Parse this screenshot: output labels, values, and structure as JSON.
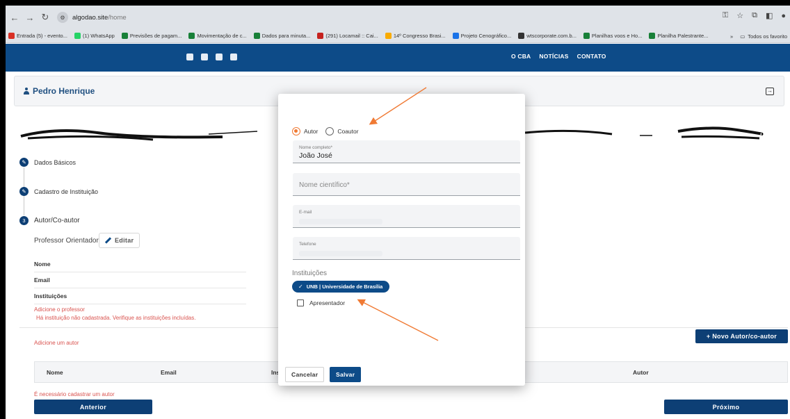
{
  "browser": {
    "url_domain": "algodao.site",
    "url_path": "/home",
    "bookmarks": [
      {
        "label": "Entrada (5) - evento...",
        "color": "#d93025"
      },
      {
        "label": "(1) WhatsApp",
        "color": "#25d366"
      },
      {
        "label": "Previsões de pagam...",
        "color": "#188038"
      },
      {
        "label": "Movimentação de c...",
        "color": "#188038"
      },
      {
        "label": "Dados para minuta...",
        "color": "#188038"
      },
      {
        "label": "(291) Locamail :: Cai...",
        "color": "#c5221f"
      },
      {
        "label": "14º Congresso Brasi...",
        "color": "#f9ab00"
      },
      {
        "label": "Projeto Cenográfico...",
        "color": "#1a73e8"
      },
      {
        "label": "wtscorporate.com.b...",
        "color": "#333333"
      },
      {
        "label": "Planilhas voos e Ho...",
        "color": "#188038"
      },
      {
        "label": "Planilha Palestrante...",
        "color": "#188038"
      }
    ],
    "bookmarks_more": "»",
    "all_bookmarks": "Todos os favorito"
  },
  "site": {
    "nav": [
      "O CBA",
      "NOTÍCIAS",
      "CONTATO"
    ]
  },
  "user": {
    "name": "Pedro Henrique"
  },
  "steps": {
    "step1": "Dados Básicos",
    "step2": "Cadastro de Instituição",
    "step3_num": "3",
    "step3": "Autor/Co-autor"
  },
  "professor": {
    "label": "Professor Orientador",
    "edit_label": "Editar",
    "rows": [
      "Nome",
      "Email",
      "Instituições"
    ],
    "warn_add": "Adicione o professor",
    "warn_inst": "Há instituição não cadastrada. Verifique as instituições incluídas."
  },
  "authors": {
    "add_label": "Adicione um autor",
    "new_button": "+ Novo Autor/co-autor",
    "columns": [
      "Nome",
      "Email",
      "Instit",
      "Autor"
    ],
    "required_warn": "É necessário cadastrar um autor"
  },
  "footer": {
    "prev": "Anterior",
    "next": "Próximo"
  },
  "modal": {
    "radio_autor": "Autor",
    "radio_coautor": "Coautor",
    "selected_radio": "Autor",
    "nome_label": "Nome completo*",
    "nome_value": "João José",
    "cientifico_placeholder": "Nome científico*",
    "email_label": "E-mail",
    "telefone_label": "Telefone",
    "instituicoes_title": "Instituições",
    "chip_label": "UNB | Universidade de Brasília",
    "apresentador_label": "Apresentador",
    "cancel": "Cancelar",
    "save": "Salvar"
  },
  "colors": {
    "primary": "#0d4b88",
    "accent_arrow": "#f07a34",
    "warn": "#d9534f"
  }
}
